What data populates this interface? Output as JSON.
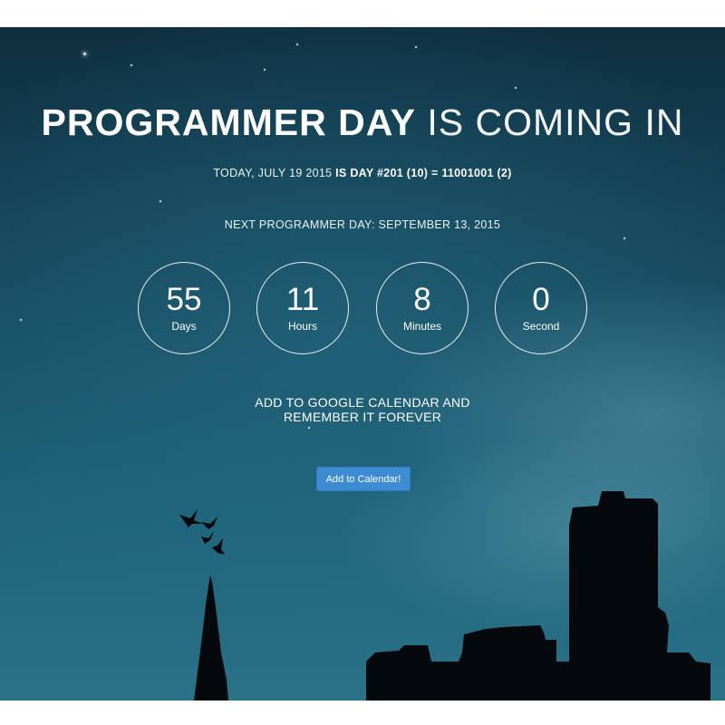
{
  "hero": {
    "title_strong": "PROGRAMMER DAY",
    "title_light": "IS COMING IN",
    "today_prefix": "TODAY, JULY 19 2015",
    "today_highlight": "IS DAY #201 (10) = 11001001 (2)",
    "next_day": "NEXT PROGRAMMER DAY: SEPTEMBER 13, 2015"
  },
  "countdown": [
    {
      "value": "55",
      "unit": "Days"
    },
    {
      "value": "11",
      "unit": "Hours"
    },
    {
      "value": "8",
      "unit": "Minutes"
    },
    {
      "value": "0",
      "unit": "Second"
    }
  ],
  "calendar": {
    "line1": "ADD TO GOOGLE CALENDAR AND",
    "line2": "REMEMBER IT FOREVER",
    "button_label": "Add to Calendar!"
  },
  "colors": {
    "sky_dark": "#0f2f40",
    "sky_light": "#2a7288",
    "button": "#3d8bd3",
    "text": "#ffffff"
  }
}
